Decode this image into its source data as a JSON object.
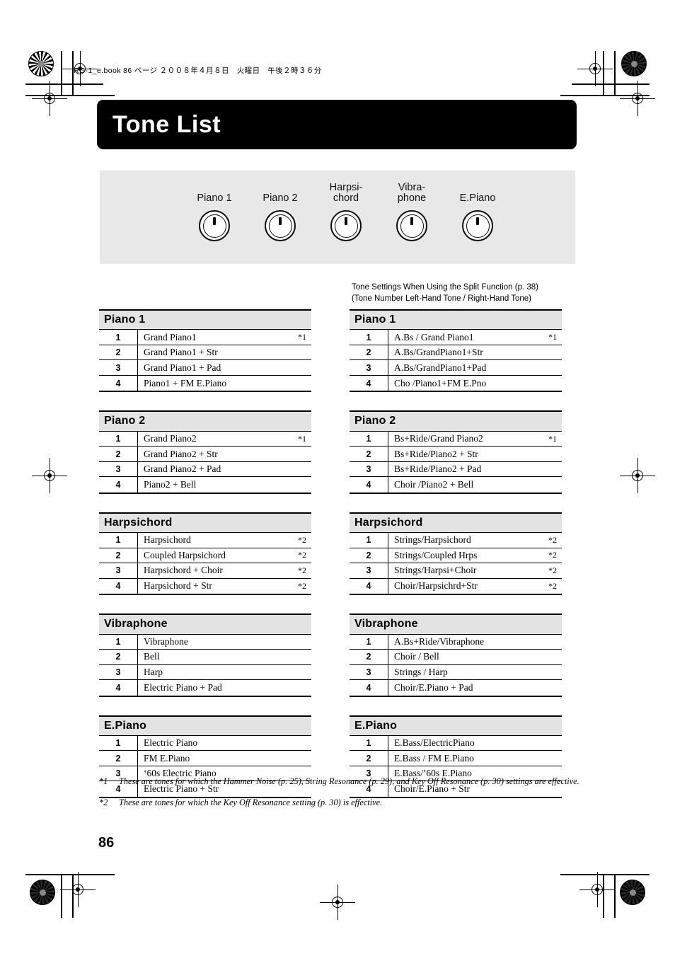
{
  "running_header": "RG-1_e.book  86 ページ  ２００８年４月８日　火曜日　午後２時３６分",
  "title": "Tone List",
  "page_number": "86",
  "panel": {
    "buttons": [
      {
        "name": "piano-1",
        "lines": [
          "Piano 1"
        ]
      },
      {
        "name": "piano-2",
        "lines": [
          "Piano 2"
        ]
      },
      {
        "name": "harpsichord",
        "lines": [
          "Harpsi-",
          "chord"
        ]
      },
      {
        "name": "vibraphone",
        "lines": [
          "Vibra-",
          "phone"
        ]
      },
      {
        "name": "e-piano",
        "lines": [
          "E.Piano"
        ]
      }
    ]
  },
  "split_note": {
    "line1": "Tone Settings When Using the Split Function (p. 38)",
    "line2": "(Tone Number Left-Hand Tone / Right-Hand Tone)"
  },
  "left_tables": [
    {
      "header": "Piano 1",
      "rows": [
        {
          "num": "1",
          "name": "Grand Piano1",
          "note": "*1"
        },
        {
          "num": "2",
          "name": "Grand Piano1 + Str",
          "note": ""
        },
        {
          "num": "3",
          "name": "Grand Piano1 + Pad",
          "note": ""
        },
        {
          "num": "4",
          "name": "Piano1 + FM E.Piano",
          "note": ""
        }
      ]
    },
    {
      "header": "Piano 2",
      "rows": [
        {
          "num": "1",
          "name": "Grand Piano2",
          "note": "*1"
        },
        {
          "num": "2",
          "name": "Grand Piano2 + Str",
          "note": ""
        },
        {
          "num": "3",
          "name": "Grand Piano2 + Pad",
          "note": ""
        },
        {
          "num": "4",
          "name": "Piano2 + Bell",
          "note": ""
        }
      ]
    },
    {
      "header": "Harpsichord",
      "rows": [
        {
          "num": "1",
          "name": "Harpsichord",
          "note": "*2"
        },
        {
          "num": "2",
          "name": "Coupled Harpsichord",
          "note": "*2"
        },
        {
          "num": "3",
          "name": "Harpsichord + Choir",
          "note": "*2"
        },
        {
          "num": "4",
          "name": "Harpsichord + Str",
          "note": "*2"
        }
      ]
    },
    {
      "header": "Vibraphone",
      "rows": [
        {
          "num": "1",
          "name": "Vibraphone",
          "note": ""
        },
        {
          "num": "2",
          "name": "Bell",
          "note": ""
        },
        {
          "num": "3",
          "name": "Harp",
          "note": ""
        },
        {
          "num": "4",
          "name": "Electric Piano + Pad",
          "note": ""
        }
      ]
    },
    {
      "header": "E.Piano",
      "rows": [
        {
          "num": "1",
          "name": "Electric Piano",
          "note": ""
        },
        {
          "num": "2",
          "name": "FM E.Piano",
          "note": ""
        },
        {
          "num": "3",
          "name": "‘60s Electric Piano",
          "note": ""
        },
        {
          "num": "4",
          "name": "Electric Piano + Str",
          "note": ""
        }
      ]
    }
  ],
  "right_tables": [
    {
      "header": "Piano 1",
      "rows": [
        {
          "num": "1",
          "name": "A.Bs / Grand Piano1",
          "note": "*1"
        },
        {
          "num": "2",
          "name": "A.Bs/GrandPiano1+Str",
          "note": ""
        },
        {
          "num": "3",
          "name": "A.Bs/GrandPiano1+Pad",
          "note": ""
        },
        {
          "num": "4",
          "name": "Cho /Piano1+FM E.Pno",
          "note": ""
        }
      ]
    },
    {
      "header": "Piano 2",
      "rows": [
        {
          "num": "1",
          "name": "Bs+Ride/Grand Piano2",
          "note": "*1"
        },
        {
          "num": "2",
          "name": "Bs+Ride/Piano2 + Str",
          "note": ""
        },
        {
          "num": "3",
          "name": "Bs+Ride/Piano2 + Pad",
          "note": ""
        },
        {
          "num": "4",
          "name": "Choir /Piano2 + Bell",
          "note": ""
        }
      ]
    },
    {
      "header": "Harpsichord",
      "rows": [
        {
          "num": "1",
          "name": "Strings/Harpsichord",
          "note": "*2"
        },
        {
          "num": "2",
          "name": "Strings/Coupled Hrps",
          "note": "*2"
        },
        {
          "num": "3",
          "name": "Strings/Harpsi+Choir",
          "note": "*2"
        },
        {
          "num": "4",
          "name": "Choir/Harpsichrd+Str",
          "note": "*2"
        }
      ]
    },
    {
      "header": "Vibraphone",
      "rows": [
        {
          "num": "1",
          "name": "A.Bs+Ride/Vibraphone",
          "note": ""
        },
        {
          "num": "2",
          "name": "Choir / Bell",
          "note": ""
        },
        {
          "num": "3",
          "name": "Strings / Harp",
          "note": ""
        },
        {
          "num": "4",
          "name": "Choir/E.Piano + Pad",
          "note": ""
        }
      ]
    },
    {
      "header": "E.Piano",
      "rows": [
        {
          "num": "1",
          "name": "E.Bass/ElectricPiano",
          "note": ""
        },
        {
          "num": "2",
          "name": "E.Bass / FM E.Piano",
          "note": ""
        },
        {
          "num": "3",
          "name": "E.Bass/’60s E.Piano",
          "note": ""
        },
        {
          "num": "4",
          "name": "Choir/E.Piano + Str",
          "note": ""
        }
      ]
    }
  ],
  "footnotes": [
    {
      "mark": "*1",
      "text": "These are tones for which the Hammer Noise (p. 25), String Resonance (p. 29), and Key Off Resonance (p. 30) settings are effective."
    },
    {
      "mark": "*2",
      "text": "These are tones for which the Key Off Resonance setting (p. 30) is effective."
    }
  ],
  "colors": {
    "title_bar": "#000000",
    "panel_bg": "#e8e8e8",
    "table_header_bg": "#e3e3e3",
    "text": "#000000"
  }
}
